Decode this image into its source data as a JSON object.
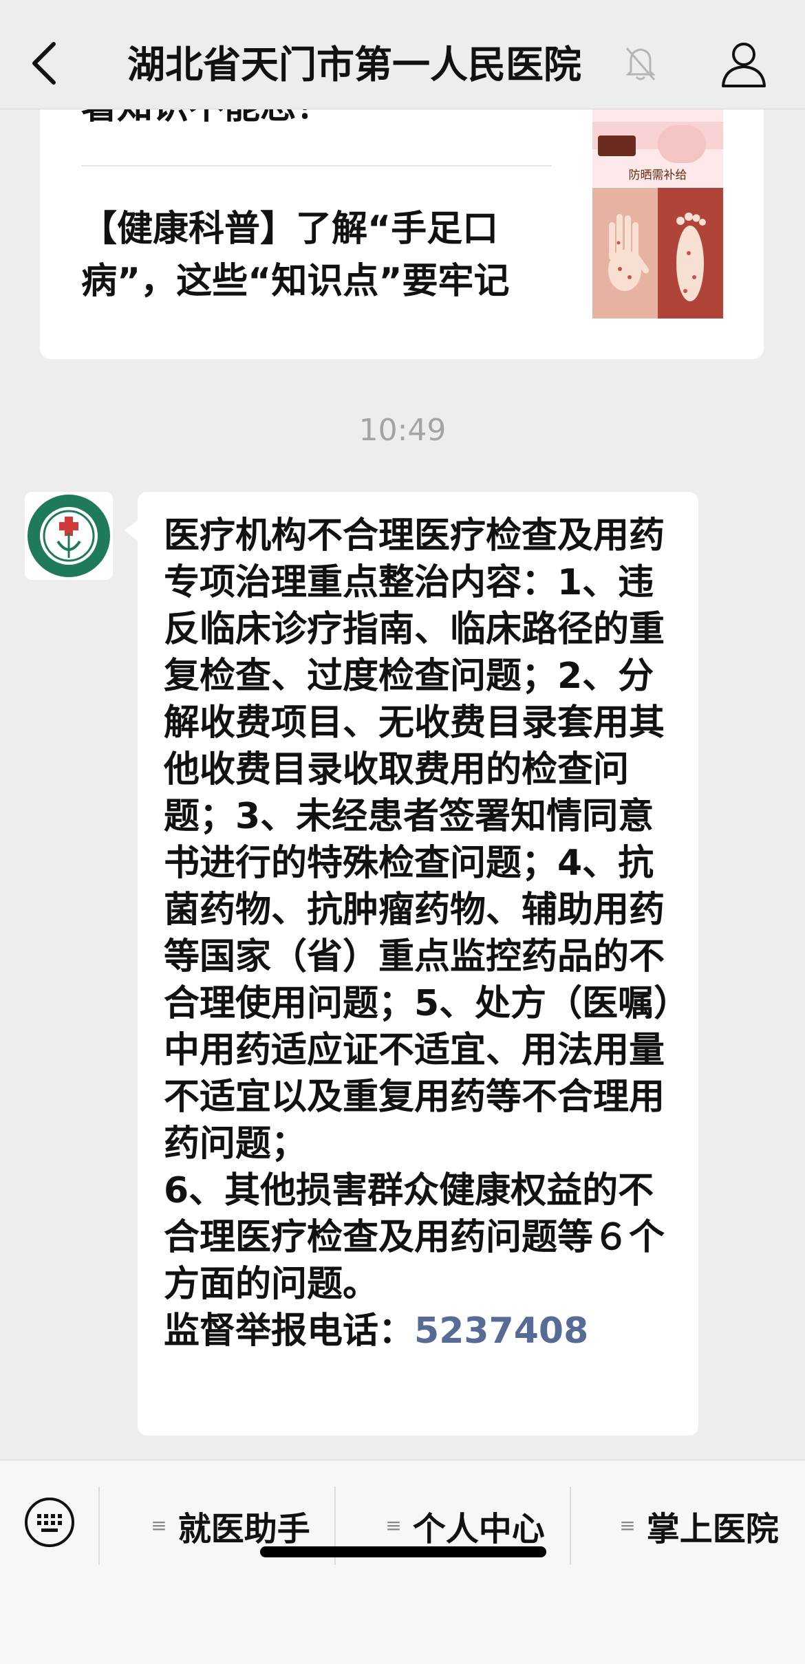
{
  "header": {
    "title": "湖北省天门市第一人民医院",
    "back_icon": "chevron-left-icon",
    "mute_icon": "bell-off-icon",
    "profile_icon": "person-icon"
  },
  "card": {
    "prev_article_title": "署知识不能忘！",
    "prev_thumb_caption": "防晒需补给",
    "article_title": "【健康科普】了解“手足口病”，这些“知识点”要牢记"
  },
  "chat": {
    "timestamp": "10:49",
    "message_body": "医疗机构不合理医疗检查及用药专项治理重点整治内容：1、违反临床诊疗指南、临床路径的重复检查、过度检查问题；2、分解收费项目、无收费目录套用其他收费目录收取费用的检查问题；3、未经患者签署知情同意书进行的特殊检查问题；4、抗菌药物、抗肿瘤药物、辅助用药等国家（省）重点监控药品的不合理使用问题；5、处方（医嘱）中用药适应证不适宜、用法用量不适宜以及重复用药等不合理用药问题；\n6、其他损害群众健康权益的不合理医疗检查及用药问题等６个方面的问题。",
    "hotline_label": "监督举报电话：",
    "hotline_number": "5237408"
  },
  "menu": {
    "items": [
      {
        "label": "就医助手"
      },
      {
        "label": "个人中心"
      },
      {
        "label": "掌上医院"
      }
    ]
  },
  "colors": {
    "background": "#ededed",
    "link": "#576b95",
    "logo_green": "#1f7a5a"
  }
}
